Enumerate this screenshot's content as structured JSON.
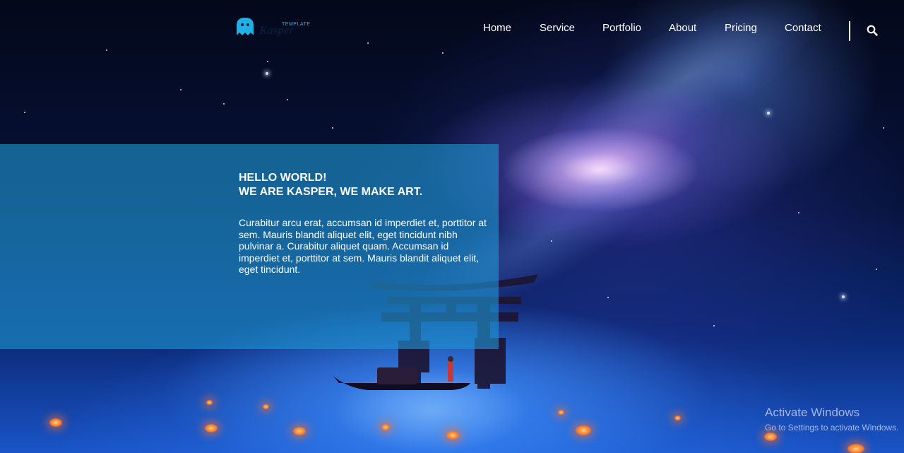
{
  "brand": {
    "name": "Kasper",
    "tag": "TEMPLATE",
    "accent_color": "#1fb0e8",
    "logo_icon": "ghost-icon"
  },
  "nav": {
    "items": [
      {
        "label": "Home"
      },
      {
        "label": "Service"
      },
      {
        "label": "Portfolio"
      },
      {
        "label": "About"
      },
      {
        "label": "Pricing"
      },
      {
        "label": "Contact"
      }
    ],
    "search_icon": "search-icon"
  },
  "intro": {
    "heading_line1": "HELLO WORLD!",
    "heading_line2": "WE ARE KASPER, WE MAKE ART.",
    "body": "Curabitur arcu erat, accumsan id imperdiet et, porttitor at sem. Mauris blandit aliquet elit, eget tincidunt nibh pulvinar a. Curabitur aliquet quam. Accumsan id imperdiet et, porttitor at sem. Mauris blandit aliquet elit, eget tincidunt.",
    "box_color": "rgba(30,150,210,0.62)"
  },
  "watermark": {
    "title": "Activate Windows",
    "subtitle": "Go to Settings to activate Windows."
  }
}
